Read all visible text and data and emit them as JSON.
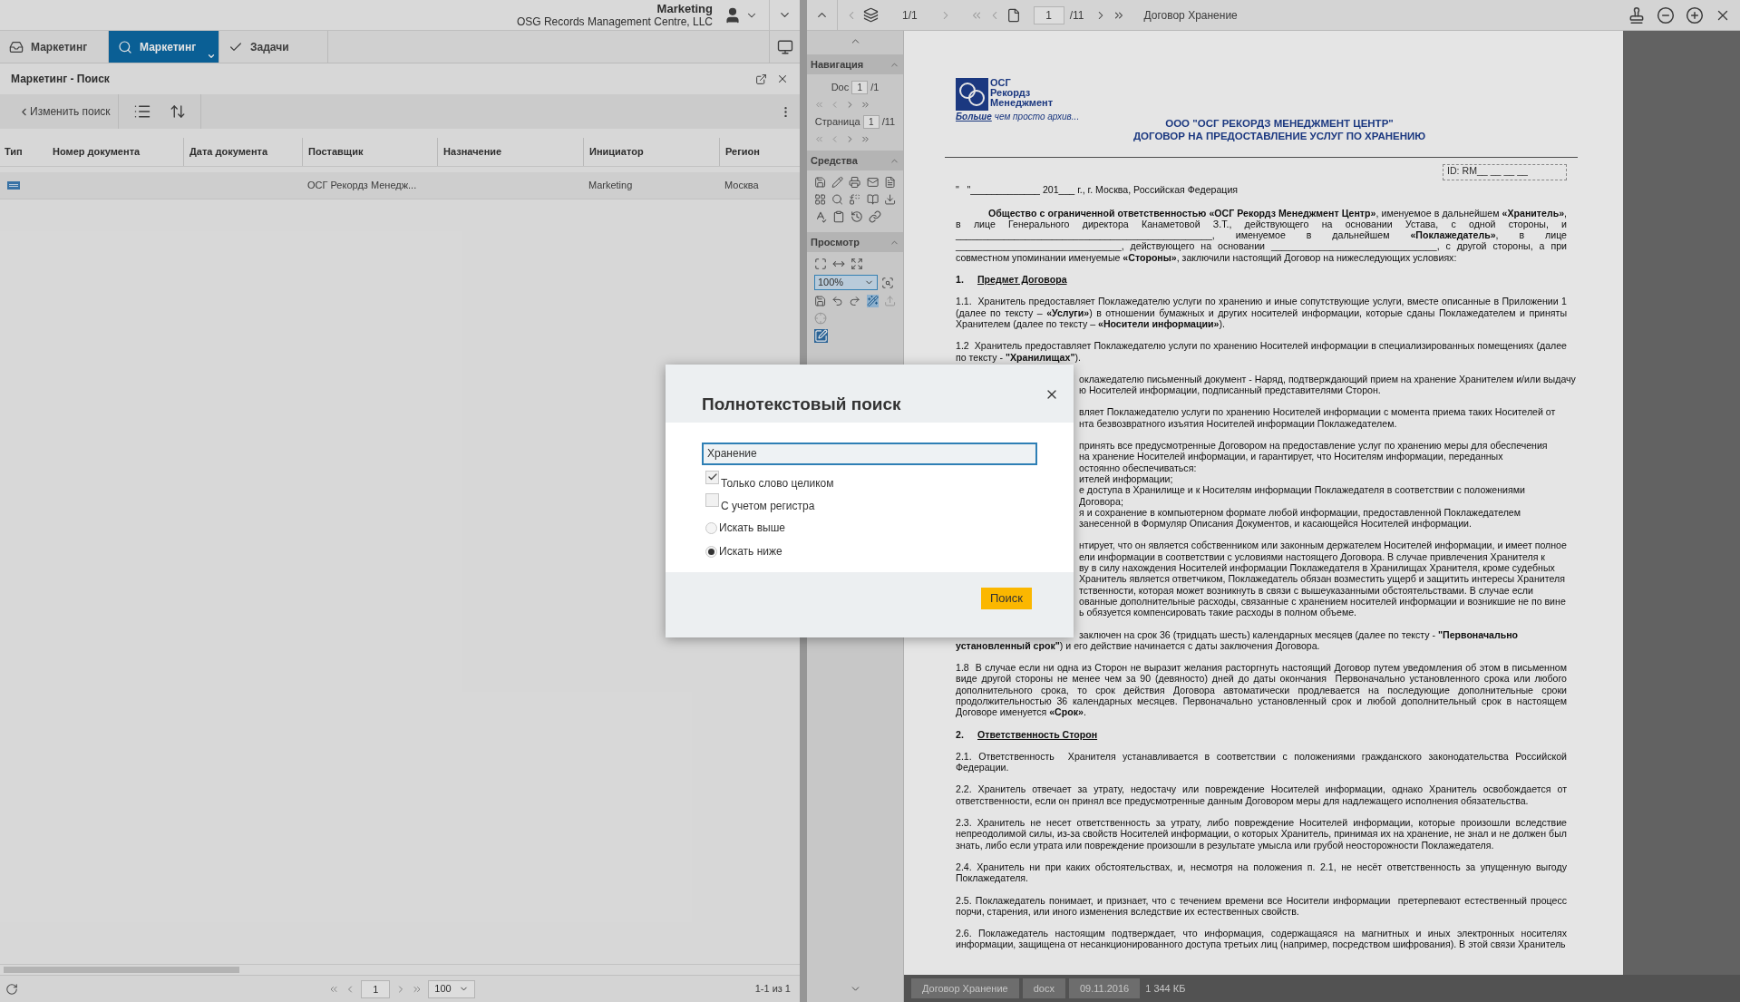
{
  "header": {
    "user_name": "Marketing",
    "organization": "OSG Records Management Centre, LLC"
  },
  "tabs": [
    {
      "kind": "inbox",
      "label": "Маркетинг",
      "selected": false
    },
    {
      "kind": "search",
      "label": "Маркетинг",
      "selected": true
    },
    {
      "kind": "tasks",
      "label": "Задачи",
      "selected": false
    }
  ],
  "panel": {
    "title": "Маркетинг - Поиск",
    "back_button": "Изменить поиск"
  },
  "table": {
    "columns": [
      "Тип",
      "Номер документа",
      "Дата документа",
      "Поставщик",
      "Назначение",
      "Инициатор",
      "Регион"
    ],
    "rows": [
      {
        "cells": [
          null,
          null,
          null,
          "ОСГ Рекордз Менедж...",
          null,
          "Marketing",
          "Москва"
        ]
      }
    ]
  },
  "pagination": {
    "page": "1",
    "page_size": "100",
    "summary": "1-1 из 1"
  },
  "viewer": {
    "toolbar": {
      "doc_count": "1/1",
      "page": "1",
      "page_total": "/11",
      "title": "Договор Хранение"
    },
    "navigation": {
      "title": "Навигация",
      "doc_label": "Doc",
      "doc_value": "1",
      "doc_total": "/1",
      "page_label": "Страница",
      "page_value": "1",
      "page_total": "/11"
    },
    "tools": {
      "title": "Средства"
    },
    "view": {
      "title": "Просмотр",
      "zoom": "100%"
    },
    "document": {
      "logo_lines": [
        "ОСГ",
        "Рекордз",
        "Менеджмент"
      ],
      "tagline_lead": "Больше",
      "tagline": "чем просто архив...",
      "title_lines": [
        "ООО \"ОСГ РЕКОРДЗ МЕНЕДЖМЕНТ ЦЕНТР\"",
        "ДОГОВОР НА ПРЕДОСТАВЛЕНИЕ УСЛУГ ПО ХРАНЕНИЮ"
      ],
      "id_field": "ID: RM__ __ __ __",
      "blocks": [
        {
          "kind": "line",
          "text": "\"   \"_____________ 201___ г., г. Москва, Российская Федерация"
        },
        {
          "kind": "lead",
          "text": "**Общество с ограниченной ответственностью «ОСГ Рекордз Менеджмент Центр»**, именуемое в дальнейшем **«Хранитель»**, в лице Генерального директора Канаметовой З.Т., действующего на основании Устава, с одной стороны, и ________________________________________________, именуемое в дальнейшем **«Поклажедатель»**, в лице _______________________________, действующего на основании _______________________________, с другой стороны, а при совместном упоминании именуемые **«Стороны»**, заключили настоящий Договор на нижеследующих условиях:"
        },
        {
          "kind": "heading",
          "number": "1.",
          "text": "Предмет Договора"
        },
        {
          "kind": "para",
          "text": "1.1.  Хранитель предоставляет Поклажедателю услуги по хранению и иные сопутствующие услуги, вместе описанные в Приложении 1 (далее по тексту – **«Услуги»**) в отношении бумажных и других носителей информации, которые сданы Поклажедателем и приняты Хранителем (далее по тексту – **«Носители информации»**)."
        },
        {
          "kind": "para",
          "text": "1.2  Хранитель предоставляет Поклажедателю услуги по хранению Носителей информации в специализированных помещениях (далее по тексту - **\"Хранилищах\"**)."
        },
        {
          "kind": "fragment",
          "lines": [
            "оклажедателю письменный документ - Наряд, подтверждающий прием на хранение Хранителем и/или выдачу",
            "ю Носителей информации, подписанный представителями Сторон."
          ]
        },
        {
          "kind": "fragment",
          "lines": [
            "вляет Поклажедателю услуги по хранению Носителей информации с момента приема таких Носителей от",
            "нта безвозвратного изъятия Носителей информации Поклажедателем."
          ]
        },
        {
          "kind": "fragment",
          "lines": [
            "принять все предусмотренные Договором на предоставление услуг по хранению меры для обеспечения",
            "на хранение Носителей информации, и гарантирует, что Носителям информации, переданных",
            "остоянно обеспечиваться:",
            "ителей информации;",
            "е доступа в Хранилище и к Носителям информации Поклажедателя в соответствии с положениями",
            "Договора;",
            "я и сохранение в компьютерном формате любой информации, предоставленной Поклажедателем",
            "занесенной в Формуляр Описания Документов, и касающейся Носителей информации."
          ]
        },
        {
          "kind": "fragment",
          "lines": [
            "нтирует, что он является собственником или законным держателем Носителей информации, и имеет полное",
            "ели информации в соответствии с условиями настоящего Договора. В случае привлечения Хранителя к",
            "ву в силу нахождения Носителей информации Поклажедателя в Хранилищах Хранителя, кроме судебных",
            "Хранитель является ответчиком, Поклажедатель обязан возместить ущерб и защитить интересы Хранителя",
            "тственности, которая может возникнуть в связи с вышеуказанными обстоятельствами. В случае если",
            "ованные дополнительные расходы, связанные с хранением носителей информации и возникшие не по вине",
            "ь обязуется компенсировать такие расходы в полном объеме."
          ]
        },
        {
          "kind": "partial",
          "covered_line": "заключен на срок 36 (тридцать шесть) календарных месяцев (далее по тексту - **\"Первоначально**",
          "text": "**установленный срок\"**) и его действие начинается с даты заключения Договора."
        },
        {
          "kind": "para",
          "text": "1.8  В случае если ни одна из Сторон не выразит желания расторгнуть настоящий Договор путем уведомления об этом в письменном виде другой стороны не менее чем за 90 (девяносто) дней до даты окончания  Первоначально установленного срока или любого дополнительного срока, то срок действия Договора автоматически продлевается на последующие дополнительные сроки продолжительностью 36 календарных месяцев. Первоначально установленный срок и любой дополнительный срок в настоящем Договоре именуется **«Срок»**."
        },
        {
          "kind": "heading",
          "number": "2.",
          "text": "Ответственность Сторон"
        },
        {
          "kind": "para",
          "text": "2.1. Ответственность  Хранителя устанавливается в соответствии с положениями гражданского законодательства Российской Федерации."
        },
        {
          "kind": "para",
          "text": "2.2. Хранитель отвечает за утрату, недостачу или повреждение Носителей информации, однако Хранитель освобождается от ответственности, если он принял все предусмотренные данным Договором меры для надлежащего исполнения обязательства."
        },
        {
          "kind": "para",
          "text": "2.3. Хранитель не несет ответственность за утрату, либо повреждение Носителей информации, которые произошли вследствие непреодолимой силы, из-за свойств Носителей информации, о которых Хранитель, принимая их на хранение, не знал и не должен был знать, либо если утрата или повреждение произошли в результате умысла или грубой неосторожности Поклажедателя."
        },
        {
          "kind": "para",
          "text": "2.4. Хранитель ни при каких обстоятельствах, и, несмотря на положения п. 2.1, не несёт ответственность за упущенную выгоду Поклажедателя."
        },
        {
          "kind": "para",
          "text": "2.5. Поклажедатель понимает, и признает, что с течением времени все Носители информации  претерпевают естественный процесс порчи, старения, или иного изменения вследствие их естественных свойств."
        },
        {
          "kind": "para",
          "text": "2.6. Поклажедатель настоящим подтверждает, что информация, содержащаяся на магнитных и иных электронных носителях информации, защищена от несанкционированного доступа третьих лиц (например, посредством шифрования). В этой связи Хранитель"
        }
      ]
    },
    "status": {
      "chips": [
        "Договор Хранение",
        "docx",
        "09.11.2016"
      ],
      "size": "1 344 КБ"
    }
  },
  "dialog": {
    "title": "Полнотекстовый поиск",
    "query": "Хранение",
    "options": [
      {
        "kind": "checkbox",
        "label": "Только слово целиком",
        "checked": true
      },
      {
        "kind": "checkbox",
        "label": "С учетом регистра",
        "checked": false
      },
      {
        "kind": "radio",
        "label": "Искать выше",
        "selected": false
      },
      {
        "kind": "radio",
        "label": "Искать ниже",
        "selected": true
      }
    ],
    "submit": "Поиск"
  }
}
